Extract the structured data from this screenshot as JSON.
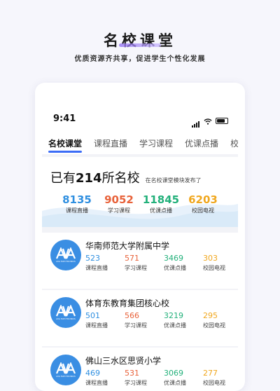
{
  "hero": {
    "title": "名校课堂",
    "subtitle": "优质资源齐共享，促进学生个性化发展"
  },
  "status": {
    "time": "9:41"
  },
  "tabs": [
    "名校课堂",
    "课程直播",
    "学习课程",
    "优课点播",
    "校"
  ],
  "summary": {
    "prefix": "已有",
    "count": "214",
    "suffix": "所名校",
    "note": "在名校课堂模块发布了",
    "stats": [
      {
        "value": "8135",
        "label": "课程直播",
        "color": "#2f8fe0"
      },
      {
        "value": "9052",
        "label": "学习课程",
        "color": "#e8623a"
      },
      {
        "value": "11845",
        "label": "优课点播",
        "color": "#22b07a"
      },
      {
        "value": "6203",
        "label": "校园电视",
        "color": "#f0a71e"
      }
    ]
  },
  "schools": [
    {
      "name": "华南师范大学附属中学",
      "logo_text": "AVA ELECTRONICS",
      "stats": [
        {
          "value": "523",
          "label": "课程直播"
        },
        {
          "value": "571",
          "label": "学习课程"
        },
        {
          "value": "3469",
          "label": "优课点播"
        },
        {
          "value": "303",
          "label": "校园电视"
        }
      ]
    },
    {
      "name": "体育东教育集团核心校",
      "logo_text": "AVA ELECTRONICS",
      "stats": [
        {
          "value": "501",
          "label": "课程直播"
        },
        {
          "value": "566",
          "label": "学习课程"
        },
        {
          "value": "3219",
          "label": "优课点播"
        },
        {
          "value": "295",
          "label": "校园电视"
        }
      ]
    },
    {
      "name": "佛山三水区思贤小学",
      "logo_text": "AVA ELECTRONICS",
      "stats": [
        {
          "value": "469",
          "label": "课程直播"
        },
        {
          "value": "531",
          "label": "学习课程"
        },
        {
          "value": "3069",
          "label": "优课点播"
        },
        {
          "value": "277",
          "label": "校园电视"
        }
      ]
    }
  ],
  "stat_colors": [
    "#2f8fe0",
    "#e8623a",
    "#22b07a",
    "#f0a71e"
  ]
}
